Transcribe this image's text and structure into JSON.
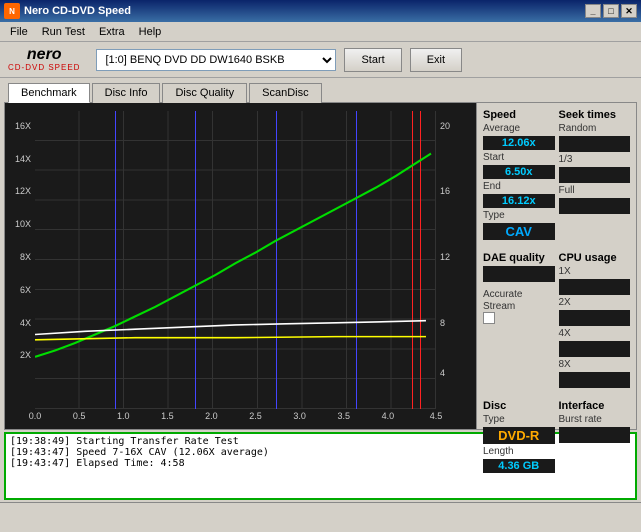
{
  "window": {
    "title": "Nero CD-DVD Speed",
    "controls": [
      "minimize",
      "maximize",
      "close"
    ]
  },
  "menu": {
    "items": [
      "File",
      "Run Test",
      "Extra",
      "Help"
    ]
  },
  "toolbar": {
    "drive_value": "[1:0]  BENQ DVD DD DW1640 BSKB",
    "start_label": "Start",
    "exit_label": "Exit"
  },
  "tabs": [
    {
      "label": "Benchmark",
      "active": true
    },
    {
      "label": "Disc Info",
      "active": false
    },
    {
      "label": "Disc Quality",
      "active": false
    },
    {
      "label": "ScanDisc",
      "active": false
    }
  ],
  "chart": {
    "y_labels_left": [
      "16X",
      "14X",
      "12X",
      "10X",
      "8X",
      "6X",
      "4X",
      "2X"
    ],
    "y_values_left": [
      16,
      14,
      12,
      10,
      8,
      6,
      4,
      2
    ],
    "y_labels_right": [
      "20",
      "16",
      "12",
      "8",
      "4"
    ],
    "x_labels": [
      "0.0",
      "0.5",
      "1.0",
      "1.5",
      "2.0",
      "2.5",
      "3.0",
      "3.5",
      "4.0",
      "4.5"
    ]
  },
  "speed_panel": {
    "title": "Speed",
    "average_label": "Average",
    "average_value": "12.06x",
    "start_label": "Start",
    "start_value": "6.50x",
    "end_label": "End",
    "end_value": "16.12x",
    "type_label": "Type",
    "type_value": "CAV"
  },
  "seek_times": {
    "title": "Seek times",
    "random_label": "Random",
    "random_value": "",
    "onethird_label": "1/3",
    "onethird_value": "",
    "full_label": "Full",
    "full_value": ""
  },
  "dae_quality": {
    "title": "DAE quality",
    "value": ""
  },
  "accurate_stream": {
    "label": "Accurate Stream"
  },
  "cpu_usage": {
    "title": "CPU usage",
    "1x_label": "1X",
    "1x_value": "",
    "2x_label": "2X",
    "2x_value": "",
    "4x_label": "4X",
    "4x_value": "",
    "8x_label": "8X",
    "8x_value": ""
  },
  "disc": {
    "title": "Disc",
    "type_label": "Type",
    "type_value": "DVD-R",
    "length_label": "Length",
    "length_value": "4.36 GB"
  },
  "interface": {
    "title": "Interface",
    "burst_label": "Burst rate",
    "burst_value": ""
  },
  "log": {
    "entries": [
      "[19:38:49]  Starting Transfer Rate Test",
      "[19:43:47]  Speed 7-16X CAV (12.06X average)",
      "[19:43:47]  Elapsed Time: 4:58"
    ]
  }
}
